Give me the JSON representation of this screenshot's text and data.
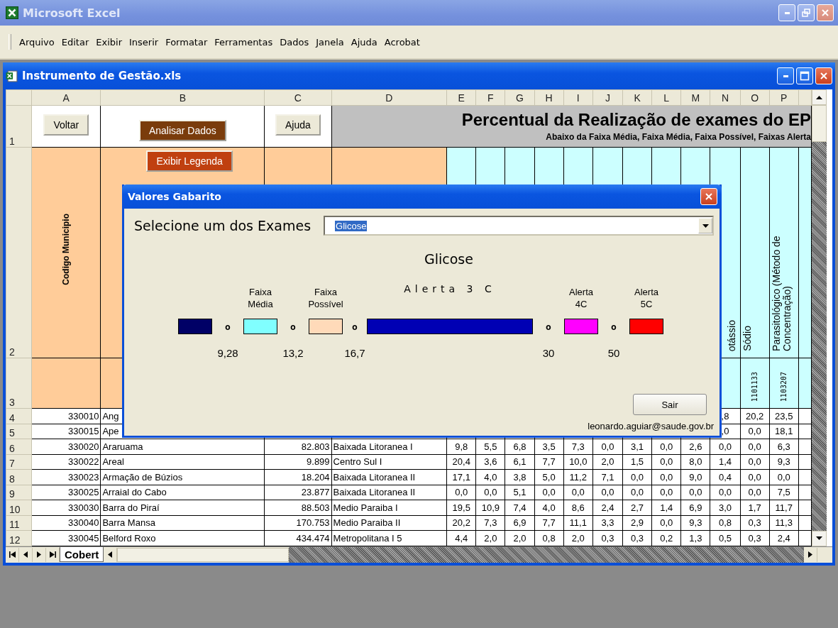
{
  "app_window": {
    "title": "Microsoft Excel"
  },
  "menu": [
    "Arquivo",
    "Editar",
    "Exibir",
    "Inserir",
    "Formatar",
    "Ferramentas",
    "Dados",
    "Janela",
    "Ajuda",
    "Acrobat"
  ],
  "workbook_window": {
    "title": "Instrumento de Gestão.xls"
  },
  "columns": [
    {
      "letter": "A",
      "button": {
        "label": "Voltar",
        "color": "#ece9d8"
      },
      "label": "Codigo Municipio"
    },
    {
      "letter": "B",
      "button": {
        "label": "Analisar Dados",
        "color": "#7a3c0c"
      }
    },
    {
      "letter": "C",
      "button": {
        "label": "Ajuda",
        "color": "#ece9d8"
      }
    },
    {
      "letter": "D"
    },
    {
      "letter": "E"
    },
    {
      "letter": "F"
    },
    {
      "letter": "G"
    },
    {
      "letter": "H"
    },
    {
      "letter": "I"
    },
    {
      "letter": "J"
    },
    {
      "letter": "K"
    },
    {
      "letter": "L"
    },
    {
      "letter": "M"
    },
    {
      "letter": "N",
      "label": "otássio"
    },
    {
      "letter": "O",
      "label": "Sódio",
      "code": "1101133"
    },
    {
      "letter": "P",
      "label": "Parasitológico (Método de Concentração)",
      "code": "1103207"
    }
  ],
  "row_numbers": {
    "buttons": "1",
    "labels": "2",
    "codes": "3"
  },
  "legend_button": {
    "label": "Exibir Legenda",
    "color": "#c04010"
  },
  "banner": {
    "title": "Percentual da Realização de exames do EP",
    "subtitle": "Abaixo da Faixa Média, Faixa Média, Faixa Possível, Faixas Alerta"
  },
  "rows": [
    {
      "number": "4",
      "code": "330010",
      "name": "Ang",
      "values": [
        ",8",
        "20,2",
        "23,5"
      ]
    },
    {
      "number": "5",
      "code": "330015",
      "name": "Ape",
      "values": [
        ",0",
        "0,0",
        "18,1"
      ]
    },
    {
      "number": "6",
      "code": "330020",
      "name": "Araruama",
      "population": "82.803",
      "region": "Baixada Litoranea I",
      "values": [
        "9,8",
        "5,5",
        "6,8",
        "3,5",
        "7,3",
        "0,0",
        "3,1",
        "0,0",
        "2,6",
        "0,0",
        "0,0",
        "6,3"
      ]
    },
    {
      "number": "7",
      "code": "330022",
      "name": "Areal",
      "population": "9.899",
      "region": "Centro Sul I",
      "values": [
        "20,4",
        "3,6",
        "6,1",
        "7,7",
        "10,0",
        "2,0",
        "1,5",
        "0,0",
        "8,0",
        "1,4",
        "0,0",
        "9,3"
      ]
    },
    {
      "number": "8",
      "code": "330023",
      "name": "Armação de Búzios",
      "population": "18.204",
      "region": "Baixada Litoranea II",
      "values": [
        "17,1",
        "4,0",
        "3,8",
        "5,0",
        "11,2",
        "7,1",
        "0,0",
        "0,0",
        "9,0",
        "0,4",
        "0,0",
        "0,0"
      ]
    },
    {
      "number": "9",
      "code": "330025",
      "name": "Arraial do Cabo",
      "population": "23.877",
      "region": "Baixada Litoranea II",
      "values": [
        "0,0",
        "0,0",
        "5,1",
        "0,0",
        "0,0",
        "0,0",
        "0,0",
        "0,0",
        "0,0",
        "0,0",
        "0,0",
        "7,5"
      ]
    },
    {
      "number": "10",
      "code": "330030",
      "name": "Barra do Piraí",
      "population": "88.503",
      "region": "Medio Paraiba I",
      "values": [
        "19,5",
        "10,9",
        "7,4",
        "4,0",
        "8,6",
        "2,4",
        "2,7",
        "1,4",
        "6,9",
        "3,0",
        "1,7",
        "11,7"
      ]
    },
    {
      "number": "11",
      "code": "330040",
      "name": "Barra Mansa",
      "population": "170.753",
      "region": "Medio Paraiba II",
      "values": [
        "20,2",
        "7,3",
        "6,9",
        "7,7",
        "11,1",
        "3,3",
        "2,9",
        "0,0",
        "9,3",
        "0,8",
        "0,3",
        "11,3"
      ]
    },
    {
      "number": "12",
      "code": "330045",
      "name": "Belford Roxo",
      "population": "434.474",
      "region": "Metropolitana I 5",
      "values": [
        "4,4",
        "2,0",
        "2,0",
        "0,8",
        "2,0",
        "0,3",
        "0,3",
        "0,2",
        "1,3",
        "0,5",
        "0,3",
        "2,4"
      ]
    }
  ],
  "sheet_tabs": [
    {
      "label": "Cobert",
      "selected": true
    }
  ],
  "dialog": {
    "title": "Valores Gabarito",
    "select_label": "Selecione um dos Exames",
    "select_value": "Glicose",
    "heading": "Glicose",
    "bands": [
      {
        "kind": "swatch",
        "color": "#000066"
      },
      {
        "kind": "swatch",
        "label": "Faixa Média",
        "color": "#80ffff"
      },
      {
        "kind": "swatch",
        "label": "Faixa Possível",
        "color": "#ffdab9"
      },
      {
        "kind": "bar",
        "label": "Alerta 3 C",
        "color": "#0000b4"
      },
      {
        "kind": "swatch",
        "label": "Alerta 4C",
        "color": "#ff00ff"
      },
      {
        "kind": "swatch",
        "label": "Alerta 5C",
        "color": "#ff0000"
      }
    ],
    "separators": [
      {
        "mark": "o",
        "value": "9,28"
      },
      {
        "mark": "o",
        "value": "13,2"
      },
      {
        "mark": "o",
        "value": "16,7"
      },
      {
        "mark": "o",
        "value": "30"
      },
      {
        "mark": "o",
        "value": "50"
      }
    ],
    "exit_button": "Sair",
    "contact": "leonardo.aguiar@saude.gov.br"
  }
}
